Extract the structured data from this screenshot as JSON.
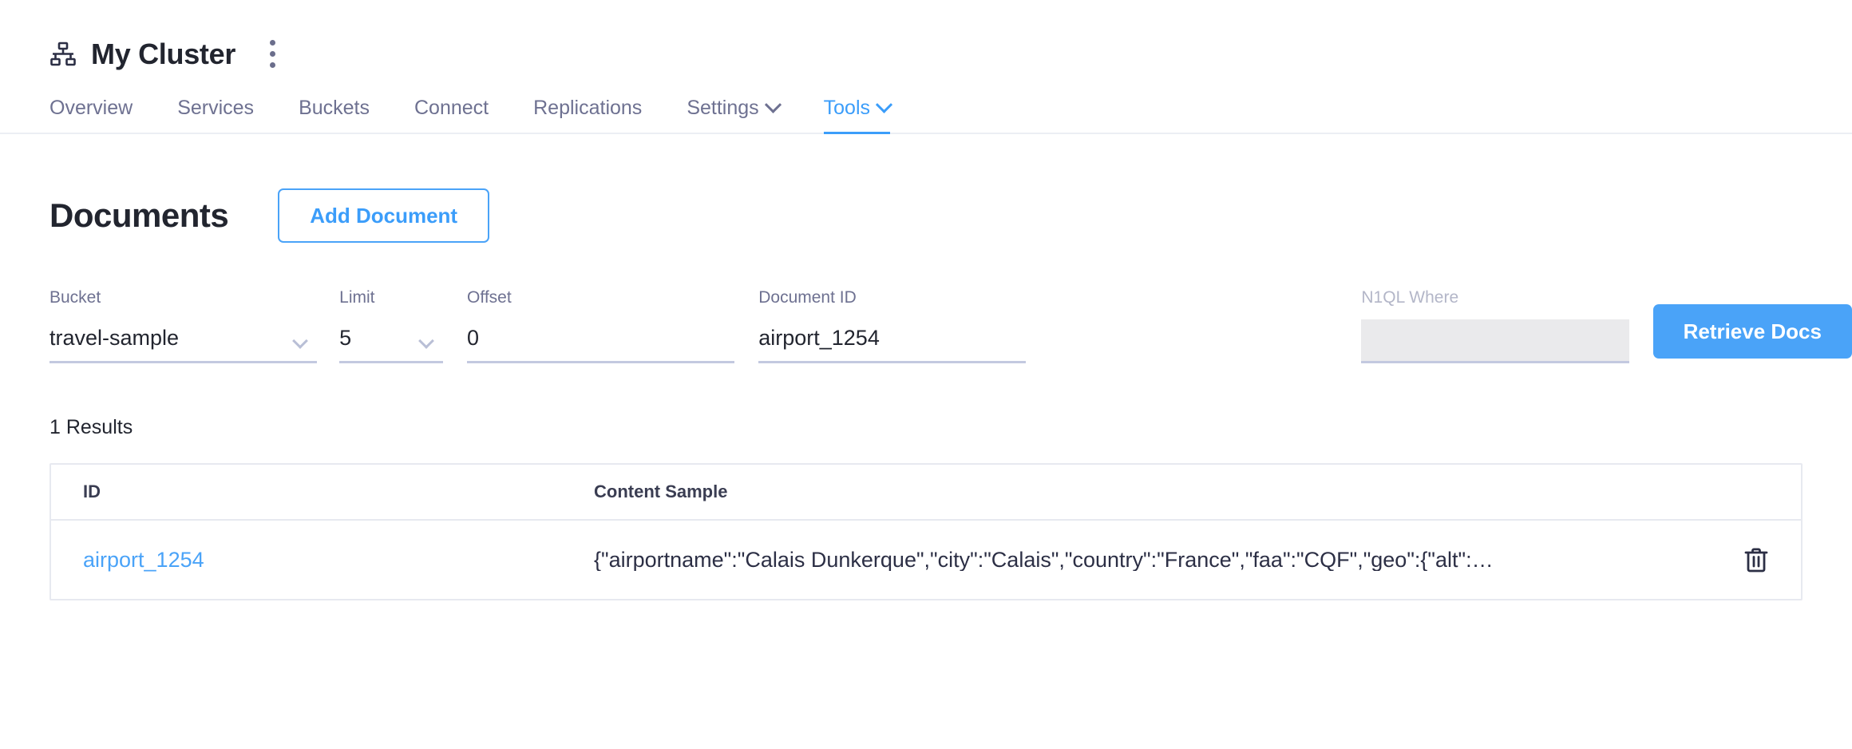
{
  "header": {
    "cluster_icon": "sitemap-icon",
    "title": "My Cluster",
    "menu_icon": "kebab-menu-icon"
  },
  "nav": {
    "tabs": [
      {
        "label": "Overview",
        "active": false,
        "has_chevron": false
      },
      {
        "label": "Services",
        "active": false,
        "has_chevron": false
      },
      {
        "label": "Buckets",
        "active": false,
        "has_chevron": false
      },
      {
        "label": "Connect",
        "active": false,
        "has_chevron": false
      },
      {
        "label": "Replications",
        "active": false,
        "has_chevron": false
      },
      {
        "label": "Settings",
        "active": false,
        "has_chevron": true
      },
      {
        "label": "Tools",
        "active": true,
        "has_chevron": true
      }
    ]
  },
  "documents": {
    "title": "Documents",
    "add_document_label": "Add Document"
  },
  "controls": {
    "bucket": {
      "label": "Bucket",
      "value": "travel-sample",
      "type": "select",
      "disabled": false
    },
    "limit": {
      "label": "Limit",
      "value": "5",
      "type": "select",
      "disabled": false
    },
    "offset": {
      "label": "Offset",
      "value": "0",
      "type": "text",
      "disabled": false
    },
    "document_id": {
      "label": "Document ID",
      "value": "airport_1254",
      "type": "text",
      "disabled": false
    },
    "n1ql_where": {
      "label": "N1QL Where",
      "value": "",
      "type": "text",
      "disabled": true
    },
    "retrieve_label": "Retrieve Docs"
  },
  "results": {
    "count_label": "1 Results",
    "columns": {
      "id": "ID",
      "content": "Content Sample"
    },
    "rows": [
      {
        "id": "airport_1254",
        "content": "{\"airportname\":\"Calais Dunkerque\",\"city\":\"Calais\",\"country\":\"France\",\"faa\":\"CQF\",\"geo\":{\"alt\":…",
        "delete_icon": "trash-icon"
      }
    ]
  },
  "colors": {
    "accent": "#4aa3f8",
    "text_dark": "#22252f",
    "text_muted": "#6e7191",
    "border_light": "#e7e9f0",
    "disabled_fill": "#eaeaec"
  }
}
